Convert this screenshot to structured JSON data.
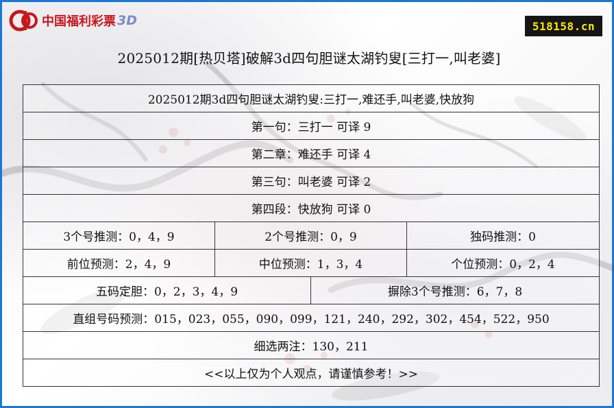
{
  "brand": {
    "logo_text": "中国福利彩票",
    "logo_suffix": "3D",
    "site_badge": "518158.cn"
  },
  "page": {
    "title": "2025012期[热贝塔]破解3d四句胆谜太湖钓叟[三打一,叫老婆]"
  },
  "riddle": {
    "heading": "2025012期3d四句胆谜太湖钓叟:三打一,难还手,叫老婆,快放狗",
    "lines": [
      "第一句：三打一 可译 9",
      "第二章：难还手 可译 4",
      "第三句：叫老婆 可译 2",
      "第四段：快放狗 可译 0"
    ]
  },
  "predictions": {
    "three_numbers": "3个号推测：0，4，9",
    "two_numbers": "2个号推测：0，9",
    "single_code": "独码推测：0",
    "front_position": "前位预测：2，4，9",
    "middle_position": "中位预测：1，3，4",
    "unit_position": "个位预测：0，2，4",
    "five_code_gall": "五码定胆：0，2，3，4，9",
    "exclude_three": "摒除3个号推测：6，7，8",
    "direct_group": "直组号码预测：015，023，055，090，099，121，240，292，302，454，522，950",
    "fine_pick": "细选两注：130，211",
    "disclaimer": "<<以上仅为个人观点，请谨慎参考！>>"
  },
  "colors": {
    "frame_border": "#1a78d6",
    "logo_red": "#c8161d",
    "badge_bg": "#151515",
    "badge_text": "#ffe600"
  }
}
